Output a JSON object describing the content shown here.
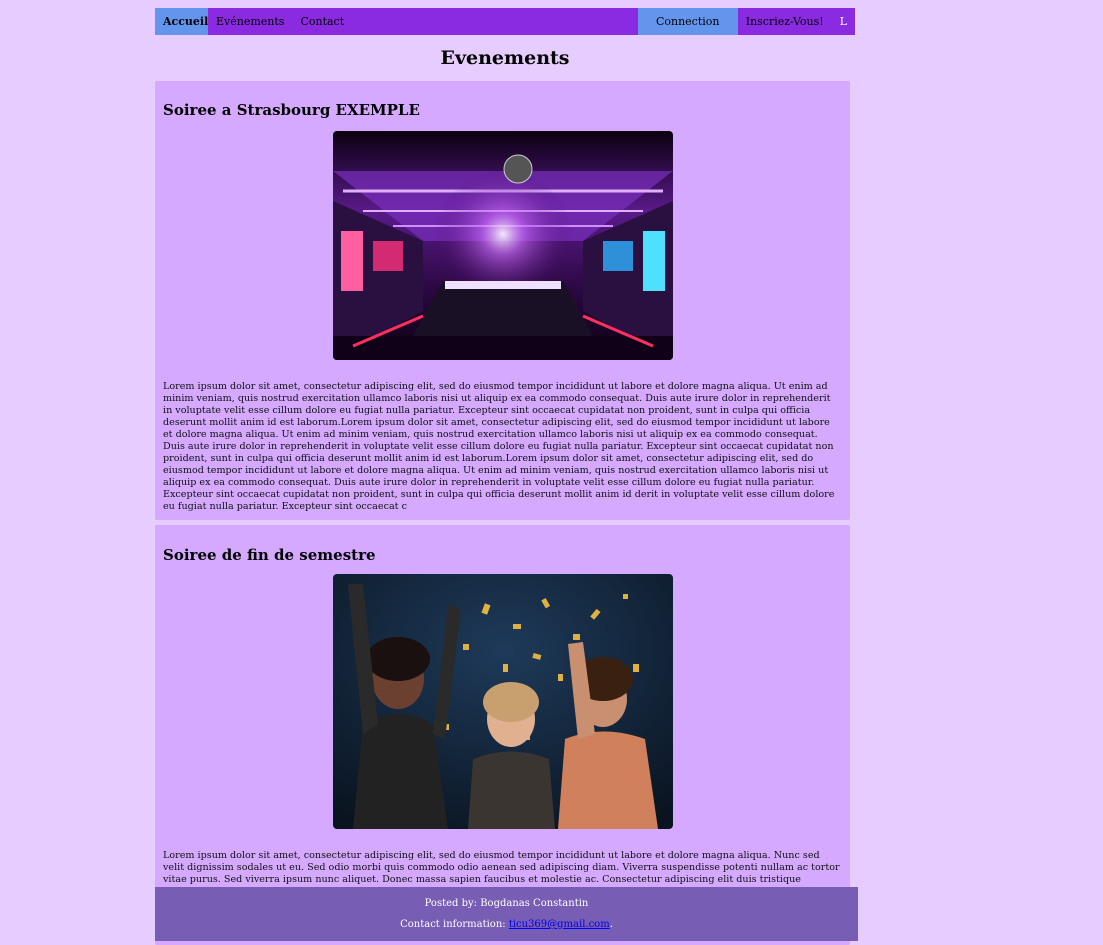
{
  "nav": {
    "home": "Accueil",
    "events": "Evénements",
    "contact": "Contact",
    "login": "Connection",
    "signup": "Inscriez-Vous!",
    "extra": "L"
  },
  "page": {
    "title": "Evenements"
  },
  "events": [
    {
      "title": "Soiree a Strasbourg EXEMPLE",
      "image_icon": "nightclub-photo",
      "text": "Lorem ipsum dolor sit amet, consectetur adipiscing elit, sed do eiusmod tempor incididunt ut labore et dolore magna aliqua. Ut enim ad minim veniam, quis nostrud exercitation ullamco laboris nisi ut aliquip ex ea commodo consequat. Duis aute irure dolor in reprehenderit in voluptate velit esse cillum dolore eu fugiat nulla pariatur. Excepteur sint occaecat cupidatat non proident, sunt in culpa qui officia deserunt mollit anim id est laborum.Lorem ipsum dolor sit amet, consectetur adipiscing elit, sed do eiusmod tempor incididunt ut labore et dolore magna aliqua. Ut enim ad minim veniam, quis nostrud exercitation ullamco laboris nisi ut aliquip ex ea commodo consequat. Duis aute irure dolor in reprehenderit in voluptate velit esse cillum dolore eu fugiat nulla pariatur. Excepteur sint occaecat cupidatat non proident, sunt in culpa qui officia deserunt mollit anim id est laborum.Lorem ipsum dolor sit amet, consectetur adipiscing elit, sed do eiusmod tempor incididunt ut labore et dolore magna aliqua. Ut enim ad minim veniam, quis nostrud exercitation ullamco laboris nisi ut aliquip ex ea commodo consequat. Duis aute irure dolor in reprehenderit in voluptate velit esse cillum dolore eu fugiat nulla pariatur. Excepteur sint occaecat cupidatat non proident, sunt in culpa qui officia deserunt mollit anim id derit in voluptate velit esse cillum dolore eu fugiat nulla pariatur. Excepteur sint occaecat c"
    },
    {
      "title": "Soiree de fin de semestre",
      "image_icon": "party-confetti-photo",
      "text": "Lorem ipsum dolor sit amet, consectetur adipiscing elit, sed do eiusmod tempor incididunt ut labore et dolore magna aliqua. Nunc sed velit dignissim sodales ut eu. Sed odio morbi quis commodo odio aenean sed adipiscing diam. Viverra suspendisse potenti nullam ac tortor vitae purus. Sed viverra ipsum nunc aliquet. Donec massa sapien faucibus et molestie ac. Consectetur adipiscing elit duis tristique sollicitudin nibh. Cursus"
    }
  ],
  "footer": {
    "posted_by": "Posted by: Bogdanas Constantin",
    "contact_label": "Contact information: ",
    "email": "ticu369@gmail.com",
    "email_suffix": "."
  }
}
